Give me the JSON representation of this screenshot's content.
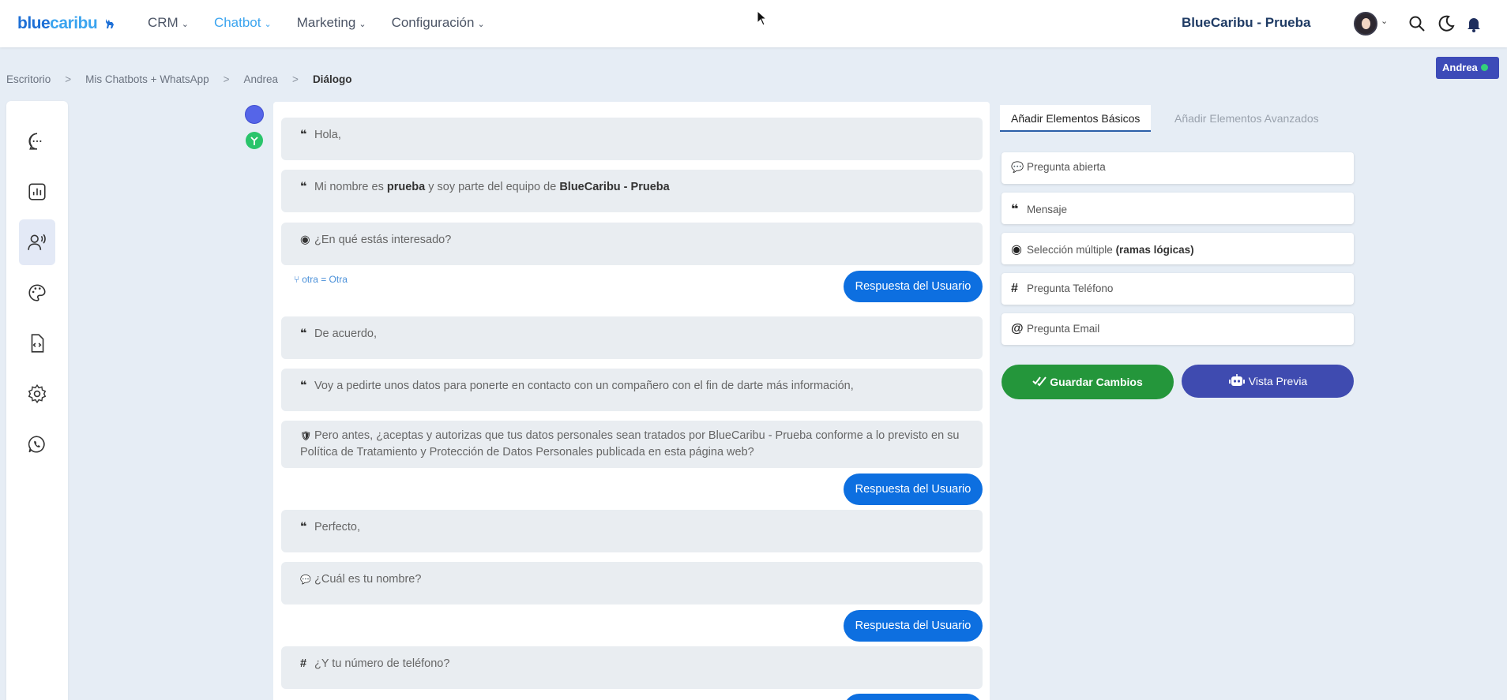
{
  "brand": {
    "logo_blue": "blue",
    "logo_caribu": "caribu",
    "deer": "🦌"
  },
  "nav": {
    "items": [
      {
        "label": "CRM",
        "active": false
      },
      {
        "label": "Chatbot",
        "active": true
      },
      {
        "label": "Marketing",
        "active": false
      },
      {
        "label": "Configuración",
        "active": false
      }
    ],
    "chevron": "⌄"
  },
  "header": {
    "company": "BlueCaribu - Prueba"
  },
  "breadcrumb": {
    "items": [
      "Escritorio",
      "Mis Chatbots + WhatsApp",
      "Andrea"
    ],
    "current": "Diálogo",
    "separator": ">"
  },
  "user_badge": {
    "label": "Andrea",
    "status_color": "#33d17a"
  },
  "sidebar": {
    "items": [
      {
        "icon": "chat-bubble-icon",
        "active": false
      },
      {
        "icon": "bar-chart-icon",
        "active": false
      },
      {
        "icon": "user-voice-icon",
        "active": true
      },
      {
        "icon": "palette-icon",
        "active": false
      },
      {
        "icon": "code-file-icon",
        "active": false
      },
      {
        "icon": "gear-icon",
        "active": false
      },
      {
        "icon": "whatsapp-icon",
        "active": false
      }
    ]
  },
  "dialog": {
    "messages": [
      {
        "icon": "❝",
        "text": "Hola,"
      },
      {
        "icon": "❝",
        "pre": "Mi nombre es ",
        "b1": "prueba",
        "mid": " y soy parte del equipo de ",
        "b2": "BlueCaribu - Prueba"
      },
      {
        "icon": "◉",
        "text": "¿En qué estás interesado?"
      },
      {
        "icon": "❝",
        "text": "De acuerdo,"
      },
      {
        "icon": "❝",
        "text": "Voy a pedirte unos datos para ponerte en contacto con un compañero con el fin de darte más información,"
      },
      {
        "icon": "🛡",
        "text": "Pero antes, ¿aceptas y autorizas que tus datos personales sean tratados por BlueCaribu - Prueba conforme a lo previsto en su Política de Tratamiento y Protección de Datos Personales publicada en esta página web?"
      },
      {
        "icon": "❝",
        "text": "Perfecto,"
      },
      {
        "icon": "💬",
        "text": "¿Cuál es tu nombre?"
      },
      {
        "icon": "#",
        "text": "¿Y tu número de teléfono?"
      }
    ],
    "branch": "otra = Otra",
    "response_label": "Respuesta del Usuario"
  },
  "panel": {
    "tab_basic": "Añadir Elementos Básicos",
    "tab_advanced": "Añadir Elementos Avanzados",
    "elements": [
      {
        "icon": "💬",
        "label": "Pregunta abierta"
      },
      {
        "icon": "❝",
        "label": "Mensaje"
      },
      {
        "icon": "◉",
        "label": "Selección múltiple ",
        "bold": "(ramas lógicas)"
      },
      {
        "icon": "#",
        "label": "Pregunta Teléfono"
      },
      {
        "icon": "@",
        "label": "Pregunta Email"
      }
    ],
    "save_label": "Guardar Cambios",
    "preview_label": "Vista Previa"
  }
}
